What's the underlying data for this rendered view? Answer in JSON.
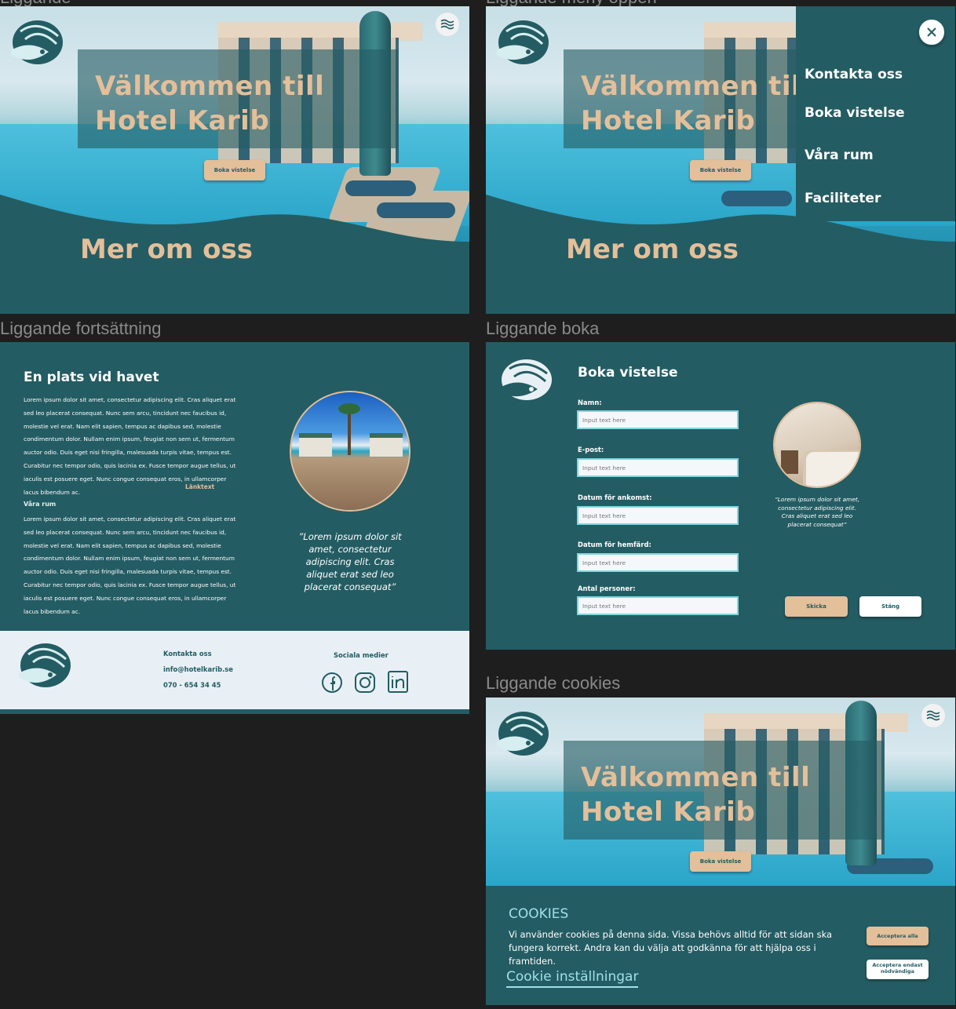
{
  "labels": {
    "top_left_partial": "Liggande",
    "top_right_partial": "Liggande meny öppen",
    "continuation": "Liggande fortsättning",
    "book": "Liggande boka",
    "cookies": "Liggande cookies"
  },
  "hero": {
    "title_line1": "Välkommen till",
    "title_line2": "Hotel Karib",
    "book_button": "Boka vistelse",
    "more_about": "Mer om oss"
  },
  "menu": {
    "items": [
      "Kontakta oss",
      "Boka vistelse",
      "Våra rum",
      "Faciliteter"
    ]
  },
  "continuation": {
    "heading": "En plats vid havet",
    "para1": "Lorem ipsum dolor sit amet, consectetur adipiscing elit. Cras aliquet erat sed leo placerat consequat. Nunc sem arcu, tincidunt nec faucibus id, molestie vel erat. Nam elit sapien, tempus ac dapibus sed, molestie condimentum dolor. Nullam enim ipsum, feugiat non sem ut, fermentum auctor odio. Duis eget nisi fringilla, malesuada turpis vitae, tempus est. Curabitur nec tempor odio, quis lacinia ex. Fusce tempor augue tellus, ut iaculis est posuere eget. Nunc congue consequat eros, in ullamcorper lacus bibendum ac.",
    "link_text": "Länktext",
    "rooms_heading": "Våra rum",
    "para2": "Lorem ipsum dolor sit amet, consectetur adipiscing elit. Cras aliquet erat sed leo placerat consequat. Nunc sem arcu, tincidunt nec faucibus id, molestie vel erat. Nam elit sapien, tempus ac dapibus sed, molestie condimentum dolor. Nullam enim ipsum, feugiat non sem ut, fermentum auctor odio. Duis eget nisi fringilla, malesuada turpis vitae, tempus est. Curabitur nec tempor odio, quis lacinia ex. Fusce tempor augue tellus, ut iaculis est posuere eget. Nunc congue consequat eros, in ullamcorper lacus bibendum ac.",
    "quote": "”Lorem ipsum dolor sit amet, consectetur adipiscing elit. Cras aliquet erat sed leo placerat consequat”"
  },
  "footer": {
    "contact_heading": "Kontakta oss",
    "email": "info@hotelkarib.se",
    "phone": "070 - 654 34 45",
    "social_heading": "Sociala medier",
    "social_icons": [
      "facebook-icon",
      "instagram-icon",
      "linkedin-icon"
    ]
  },
  "booking": {
    "heading": "Boka vistelse",
    "fields": [
      {
        "label": "Namn:",
        "placeholder": "Input text here"
      },
      {
        "label": "E-post:",
        "placeholder": "Input text here"
      },
      {
        "label": "Datum för ankomst:",
        "placeholder": "Input text here"
      },
      {
        "label": "Datum för hemfärd:",
        "placeholder": "Input text here"
      },
      {
        "label": "Antal personer:",
        "placeholder": "Input text here"
      }
    ],
    "quote": "”Lorem ipsum dolor sit amet, consectetur adipiscing elit. Cras aliquet erat sed leo placerat consequat”",
    "submit": "Skicka",
    "close": "Stäng"
  },
  "cookies": {
    "title": "COOKIES",
    "text": "Vi använder cookies på denna sida. Vissa behövs alltid för att sidan ska fungera korrekt. Andra kan du välja att godkänna för att hjälpa oss i framtiden.",
    "settings_link": "Cookie inställningar",
    "accept_all": "Acceptera alla",
    "accept_necessary": "Acceptera endast nödvändiga"
  },
  "colors": {
    "teal": "#245c63",
    "sand": "#e3bf9a",
    "light": "#e8f0f6",
    "aqua": "#7fd7e0",
    "canvas": "#1e1e1e"
  }
}
